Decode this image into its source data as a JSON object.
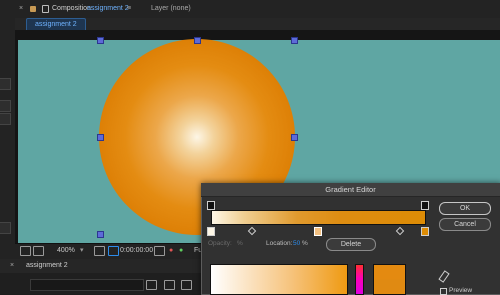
{
  "tabbar": {
    "close_glyph": "×",
    "comp_prefix": "Composition",
    "comp_name": "assignment 2",
    "menu_glyph": "≡",
    "layer_label": "Layer (none)"
  },
  "viewer": {
    "comp_breadcrumb": "assignment 2"
  },
  "toolbar": {
    "zoom": "400%",
    "timecode": "0:00:00:00",
    "resolution": "Full"
  },
  "timeline": {
    "tab_label": "assignment 2"
  },
  "gradient_editor": {
    "title": "Gradient Editor",
    "ok_label": "OK",
    "cancel_label": "Cancel",
    "opacity_label": "Opacity:",
    "opacity_unit": "%",
    "location_label": "Location:",
    "location_value": "50",
    "location_unit": "%",
    "delete_label": "Delete",
    "preview_label": "Preview"
  },
  "colors": {
    "accent": "#2d8ceb",
    "comp_bg": "#5fa6a3",
    "circle_outer": "#dd7f05",
    "circle_center": "#fdf6e6"
  }
}
